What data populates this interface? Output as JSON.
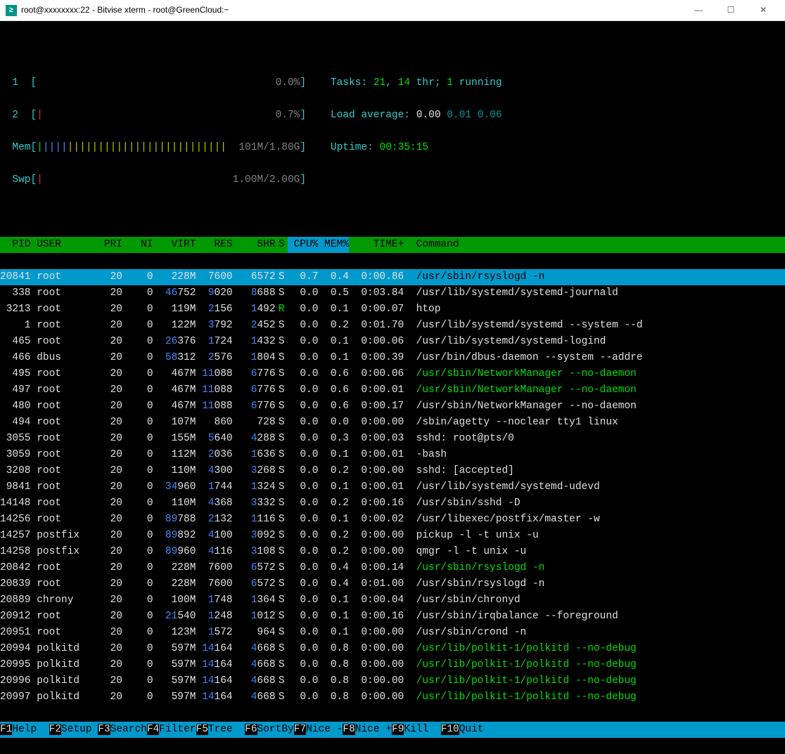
{
  "window": {
    "title": "root@xxxxxxxx:22 - Bitvise xterm - root@GreenCloud:~"
  },
  "cpu": {
    "c1_label": "1",
    "c1_pct": "0.0%",
    "c2_label": "2",
    "c2_pct": "0.7%",
    "mem_label": "Mem",
    "mem_val": "101M/1.80G",
    "swp_label": "Swp",
    "swp_val": "1.00M/2.00G"
  },
  "stats": {
    "tasks_lbl": "Tasks: ",
    "tasks_n": "21",
    "tasks_sep": ", ",
    "tasks_thr": "14",
    "thr_lbl": " thr; ",
    "run_n": "1",
    "run_lbl": " running",
    "load_lbl": "Load average: ",
    "l1": "0.00",
    "l2": "0.01",
    "l3": "0.06",
    "up_lbl": "Uptime: ",
    "up_v": "00:35:15"
  },
  "headers": {
    "pid": "PID",
    "user": "USER",
    "pri": "PRI",
    "ni": "NI",
    "virt": "VIRT",
    "res": "RES",
    "shr": "SHR",
    "s": "S",
    "cpu": "CPU%",
    "mem": "MEM%",
    "time": "TIME+",
    "cmd": "Command"
  },
  "rows": [
    {
      "pid": "20841",
      "user": "root",
      "uc": "",
      "pri": "20",
      "ni": "0",
      "v1": "",
      "v2": "228M",
      "r1": "",
      "r2": "7600",
      "s1": "",
      "s2": "6572",
      "s": "S",
      "cpu": "0.7",
      "mem": "0.4",
      "time": "0:00.86",
      "cmd": "/usr/sbin/rsyslogd -n",
      "sel": true
    },
    {
      "pid": "338",
      "user": "root",
      "uc": "",
      "pri": "20",
      "ni": "0",
      "v1": "46",
      "v2": "752",
      "r1": "9",
      "r2": "020",
      "s1": "8",
      "s2": "688",
      "s": "S",
      "cpu": "0.0",
      "mem": "0.5",
      "time": "0:03.84",
      "cmd": "/usr/lib/systemd/systemd-journald"
    },
    {
      "pid": "3213",
      "user": "root",
      "uc": "",
      "pri": "20",
      "ni": "0",
      "v1": "",
      "v2": "119M",
      "r1": "2",
      "r2": "156",
      "s1": "1",
      "s2": "492",
      "s": "R",
      "sc": "brgreen",
      "cpu": "0.0",
      "mem": "0.1",
      "time": "0:00.07",
      "cmd": "htop"
    },
    {
      "pid": "1",
      "user": "root",
      "uc": "",
      "pri": "20",
      "ni": "0",
      "v1": "",
      "v2": "122M",
      "r1": "3",
      "r2": "792",
      "s1": "2",
      "s2": "452",
      "s": "S",
      "cpu": "0.0",
      "mem": "0.2",
      "time": "0:01.70",
      "cmd": "/usr/lib/systemd/systemd --system --d"
    },
    {
      "pid": "465",
      "user": "root",
      "uc": "",
      "pri": "20",
      "ni": "0",
      "v1": "26",
      "v2": "376",
      "r1": "1",
      "r2": "724",
      "s1": "1",
      "s2": "432",
      "s": "S",
      "cpu": "0.0",
      "mem": "0.1",
      "time": "0:00.06",
      "cmd": "/usr/lib/systemd/systemd-logind"
    },
    {
      "pid": "466",
      "user": "dbus",
      "uc": "grey",
      "pri": "20",
      "ni": "0",
      "v1": "58",
      "v2": "312",
      "r1": "2",
      "r2": "576",
      "s1": "1",
      "s2": "804",
      "s": "S",
      "cpu": "0.0",
      "mem": "0.1",
      "time": "0:00.39",
      "cmd": "/usr/bin/dbus-daemon --system --addre"
    },
    {
      "pid": "495",
      "user": "root",
      "uc": "",
      "pri": "20",
      "ni": "0",
      "v1": "",
      "v2": "467M",
      "r1": "11",
      "r2": "088",
      "s1": "6",
      "s2": "776",
      "s": "S",
      "cpu": "0.0",
      "mem": "0.6",
      "time": "0:00.06",
      "cmd": "/usr/sbin/NetworkManager --no-daemon",
      "cc": "brgreen"
    },
    {
      "pid": "497",
      "user": "root",
      "uc": "",
      "pri": "20",
      "ni": "0",
      "v1": "",
      "v2": "467M",
      "r1": "11",
      "r2": "088",
      "s1": "6",
      "s2": "776",
      "s": "S",
      "cpu": "0.0",
      "mem": "0.6",
      "time": "0:00.01",
      "cmd": "/usr/sbin/NetworkManager --no-daemon",
      "cc": "brgreen"
    },
    {
      "pid": "480",
      "user": "root",
      "uc": "",
      "pri": "20",
      "ni": "0",
      "v1": "",
      "v2": "467M",
      "r1": "11",
      "r2": "088",
      "s1": "6",
      "s2": "776",
      "s": "S",
      "cpu": "0.0",
      "mem": "0.6",
      "time": "0:00.17",
      "cmd": "/usr/sbin/NetworkManager --no-daemon"
    },
    {
      "pid": "494",
      "user": "root",
      "uc": "",
      "pri": "20",
      "ni": "0",
      "v1": "",
      "v2": "107M",
      "r1": "",
      "r2": "860",
      "s1": "",
      "s2": "728",
      "s": "S",
      "cpu": "0.0",
      "mem": "0.0",
      "time": "0:00.00",
      "cmd": "/sbin/agetty --noclear tty1 linux"
    },
    {
      "pid": "3055",
      "user": "root",
      "uc": "",
      "pri": "20",
      "ni": "0",
      "v1": "",
      "v2": "155M",
      "r1": "5",
      "r2": "640",
      "s1": "4",
      "s2": "288",
      "s": "S",
      "cpu": "0.0",
      "mem": "0.3",
      "time": "0:00.03",
      "cmd": "sshd: root@pts/0"
    },
    {
      "pid": "3059",
      "user": "root",
      "uc": "",
      "pri": "20",
      "ni": "0",
      "v1": "",
      "v2": "112M",
      "r1": "2",
      "r2": "036",
      "s1": "1",
      "s2": "636",
      "s": "S",
      "cpu": "0.0",
      "mem": "0.1",
      "time": "0:00.01",
      "cmd": "-bash"
    },
    {
      "pid": "3208",
      "user": "root",
      "uc": "",
      "pri": "20",
      "ni": "0",
      "v1": "",
      "v2": "110M",
      "r1": "4",
      "r2": "300",
      "s1": "3",
      "s2": "268",
      "s": "S",
      "cpu": "0.0",
      "mem": "0.2",
      "time": "0:00.00",
      "cmd": "sshd: [accepted]"
    },
    {
      "pid": "9841",
      "user": "root",
      "uc": "",
      "pri": "20",
      "ni": "0",
      "v1": "34",
      "v2": "960",
      "r1": "1",
      "r2": "744",
      "s1": "1",
      "s2": "324",
      "s": "S",
      "cpu": "0.0",
      "mem": "0.1",
      "time": "0:00.01",
      "cmd": "/usr/lib/systemd/systemd-udevd"
    },
    {
      "pid": "14148",
      "user": "root",
      "uc": "",
      "pri": "20",
      "ni": "0",
      "v1": "",
      "v2": "110M",
      "r1": "4",
      "r2": "368",
      "s1": "3",
      "s2": "332",
      "s": "S",
      "cpu": "0.0",
      "mem": "0.2",
      "time": "0:00.16",
      "cmd": "/usr/sbin/sshd -D"
    },
    {
      "pid": "14256",
      "user": "root",
      "uc": "",
      "pri": "20",
      "ni": "0",
      "v1": "89",
      "v2": "788",
      "r1": "2",
      "r2": "132",
      "s1": "1",
      "s2": "116",
      "s": "S",
      "cpu": "0.0",
      "mem": "0.1",
      "time": "0:00.02",
      "cmd": "/usr/libexec/postfix/master -w"
    },
    {
      "pid": "14257",
      "user": "postfix",
      "uc": "grey",
      "pri": "20",
      "ni": "0",
      "v1": "89",
      "v2": "892",
      "r1": "4",
      "r2": "100",
      "s1": "3",
      "s2": "092",
      "s": "S",
      "cpu": "0.0",
      "mem": "0.2",
      "time": "0:00.00",
      "cmd": "pickup -l -t unix -u"
    },
    {
      "pid": "14258",
      "user": "postfix",
      "uc": "grey",
      "pri": "20",
      "ni": "0",
      "v1": "89",
      "v2": "960",
      "r1": "4",
      "r2": "116",
      "s1": "3",
      "s2": "108",
      "s": "S",
      "cpu": "0.0",
      "mem": "0.2",
      "time": "0:00.00",
      "cmd": "qmgr -l -t unix -u"
    },
    {
      "pid": "20842",
      "user": "root",
      "uc": "",
      "pri": "20",
      "ni": "0",
      "v1": "",
      "v2": "228M",
      "r1": "",
      "r2": "7600",
      "s1": "6",
      "s2": "572",
      "s": "S",
      "cpu": "0.0",
      "mem": "0.4",
      "time": "0:00.14",
      "cmd": "/usr/sbin/rsyslogd -n",
      "cc": "brgreen"
    },
    {
      "pid": "20839",
      "user": "root",
      "uc": "",
      "pri": "20",
      "ni": "0",
      "v1": "",
      "v2": "228M",
      "r1": "",
      "r2": "7600",
      "s1": "6",
      "s2": "572",
      "s": "S",
      "cpu": "0.0",
      "mem": "0.4",
      "time": "0:01.00",
      "cmd": "/usr/sbin/rsyslogd -n"
    },
    {
      "pid": "20889",
      "user": "chrony",
      "uc": "grey",
      "pri": "20",
      "ni": "0",
      "v1": "",
      "v2": "100M",
      "r1": "1",
      "r2": "748",
      "s1": "1",
      "s2": "364",
      "s": "S",
      "cpu": "0.0",
      "mem": "0.1",
      "time": "0:00.04",
      "cmd": "/usr/sbin/chronyd"
    },
    {
      "pid": "20912",
      "user": "root",
      "uc": "",
      "pri": "20",
      "ni": "0",
      "v1": "21",
      "v2": "540",
      "r1": "1",
      "r2": "248",
      "s1": "1",
      "s2": "012",
      "s": "S",
      "cpu": "0.0",
      "mem": "0.1",
      "time": "0:00.16",
      "cmd": "/usr/sbin/irqbalance --foreground"
    },
    {
      "pid": "20951",
      "user": "root",
      "uc": "",
      "pri": "20",
      "ni": "0",
      "v1": "",
      "v2": "123M",
      "r1": "1",
      "r2": "572",
      "s1": "",
      "s2": "964",
      "s": "S",
      "cpu": "0.0",
      "mem": "0.1",
      "time": "0:00.00",
      "cmd": "/usr/sbin/crond -n"
    },
    {
      "pid": "20994",
      "user": "polkitd",
      "uc": "grey",
      "pri": "20",
      "ni": "0",
      "v1": "",
      "v2": "597M",
      "r1": "14",
      "r2": "164",
      "s1": "4",
      "s2": "668",
      "s": "S",
      "cpu": "0.0",
      "mem": "0.8",
      "time": "0:00.00",
      "cmd": "/usr/lib/polkit-1/polkitd --no-debug",
      "cc": "brgreen"
    },
    {
      "pid": "20995",
      "user": "polkitd",
      "uc": "grey",
      "pri": "20",
      "ni": "0",
      "v1": "",
      "v2": "597M",
      "r1": "14",
      "r2": "164",
      "s1": "4",
      "s2": "668",
      "s": "S",
      "cpu": "0.0",
      "mem": "0.8",
      "time": "0:00.00",
      "cmd": "/usr/lib/polkit-1/polkitd --no-debug",
      "cc": "brgreen"
    },
    {
      "pid": "20996",
      "user": "polkitd",
      "uc": "grey",
      "pri": "20",
      "ni": "0",
      "v1": "",
      "v2": "597M",
      "r1": "14",
      "r2": "164",
      "s1": "4",
      "s2": "668",
      "s": "S",
      "cpu": "0.0",
      "mem": "0.8",
      "time": "0:00.00",
      "cmd": "/usr/lib/polkit-1/polkitd --no-debug",
      "cc": "brgreen"
    },
    {
      "pid": "20997",
      "user": "polkitd",
      "uc": "grey",
      "pri": "20",
      "ni": "0",
      "v1": "",
      "v2": "597M",
      "r1": "14",
      "r2": "164",
      "s1": "4",
      "s2": "668",
      "s": "S",
      "cpu": "0.0",
      "mem": "0.8",
      "time": "0:00.00",
      "cmd": "/usr/lib/polkit-1/polkitd --no-debug",
      "cc": "brgreen"
    }
  ],
  "fn": {
    "f1": "F1",
    "f1l": "Help  ",
    "f2": "F2",
    "f2l": "Setup ",
    "f3": "F3",
    "f3l": "Search",
    "f4": "F4",
    "f4l": "Filter",
    "f5": "F5",
    "f5l": "Tree  ",
    "f6": "F6",
    "f6l": "SortBy",
    "f7": "F7",
    "f7l": "Nice -",
    "f8": "F8",
    "f8l": "Nice +",
    "f9": "F9",
    "f9l": "Kill  ",
    "f10": "F10",
    "f10l": "Quit  "
  }
}
